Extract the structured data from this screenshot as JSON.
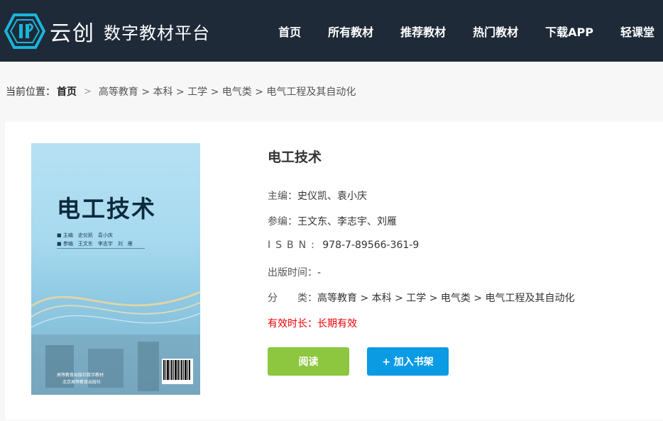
{
  "header": {
    "brand": "云创",
    "subtitle": "数字教材平台",
    "nav": [
      "首页",
      "所有教材",
      "推荐教材",
      "热门教材",
      "下载APP",
      "轻课堂"
    ]
  },
  "breadcrumb": {
    "label": "当前位置：",
    "home": "首页",
    "path": "高等教育 > 本科 > 工学 > 电气类 > 电气工程及其自动化"
  },
  "book": {
    "title": "电工技术",
    "chief_editor_label": "主编：",
    "chief_editor": "史仪凯、袁小庆",
    "co_editors_label": "参编：",
    "co_editors": "王文东、李志宇、刘雁",
    "isbn_label": "ISBN:",
    "isbn": "978-7-89566-361-9",
    "pub_time_label": "出版时间：",
    "pub_time": "-",
    "category_label": "分　　类：",
    "category": "高等教育 > 本科 > 工学 > 电气类 > 电气工程及其自动化",
    "validity_label": "有效时长：",
    "validity": "长期有效"
  },
  "cover": {
    "title": "电工技术",
    "line1": "■ 主编　史仪凯　袁小庆",
    "line2": "■ 参编　王文东　李志宇　刘　雁",
    "publisher_line1": "高等教育出版社数字教材",
    "publisher_line2": "北京高等教育出版社"
  },
  "actions": {
    "read": "阅读",
    "add_shelf": "+ 加入书架"
  },
  "colors": {
    "header_bg": "#1f2a38",
    "read_btn": "#8dc63f",
    "shelf_btn": "#0a9be4",
    "validity": "#ee0000"
  }
}
